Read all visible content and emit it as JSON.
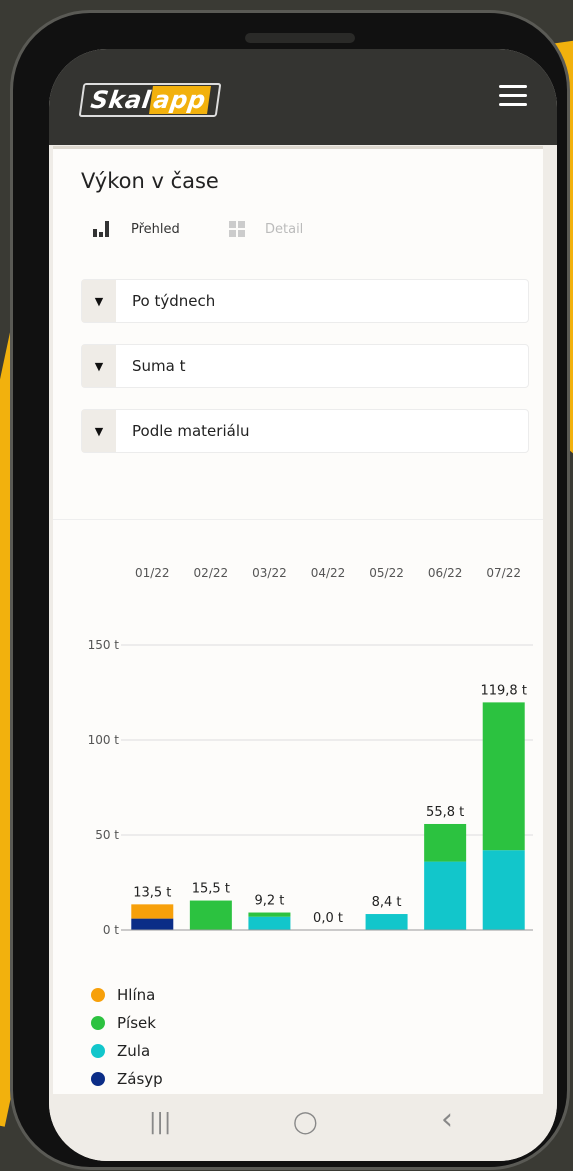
{
  "app": {
    "logo_part1": "Skal",
    "logo_part2": "app"
  },
  "page": {
    "title": "Výkon v čase"
  },
  "tabs": [
    {
      "label": "Přehled",
      "active": true
    },
    {
      "label": "Detail",
      "active": false
    }
  ],
  "selects": [
    {
      "value": "Po týdnech"
    },
    {
      "value": "Suma t"
    },
    {
      "value": "Podle materiálu"
    }
  ],
  "colors": {
    "Hlína": "#f7a00a",
    "Písek": "#2cc240",
    "Zula": "#12c6cb",
    "Zásyp": "#0b2d87",
    "brand": "#f2b10d",
    "header": "#343431"
  },
  "chart_data": {
    "type": "bar",
    "stacked": true,
    "categories": [
      "01/22",
      "02/22",
      "03/22",
      "04/22",
      "05/22",
      "06/22",
      "07/22"
    ],
    "series": [
      {
        "name": "Zásyp",
        "values": [
          6.0,
          0,
          0,
          0,
          0,
          0,
          0
        ]
      },
      {
        "name": "Zula",
        "values": [
          0,
          0,
          7.0,
          0,
          8.4,
          36.0,
          42.0
        ]
      },
      {
        "name": "Písek",
        "values": [
          0,
          15.5,
          2.2,
          0,
          0,
          19.8,
          77.8
        ]
      },
      {
        "name": "Hlína",
        "values": [
          7.5,
          0,
          0,
          0,
          0,
          0,
          0
        ]
      }
    ],
    "totals_labels": [
      "13,5 t",
      "15,5 t",
      "9,2 t",
      "0,0 t",
      "8,4 t",
      "55,8 t",
      "119,8 t"
    ],
    "y_ticks": [
      "0 t",
      "50 t",
      "100 t",
      "150 t"
    ],
    "ylim": [
      0,
      150
    ],
    "legend": [
      "Hlína",
      "Písek",
      "Zula",
      "Zásyp"
    ],
    "legend_position": "bottom-left"
  },
  "navbar": {
    "recent": "|||",
    "home": "◯",
    "back": "‹"
  }
}
